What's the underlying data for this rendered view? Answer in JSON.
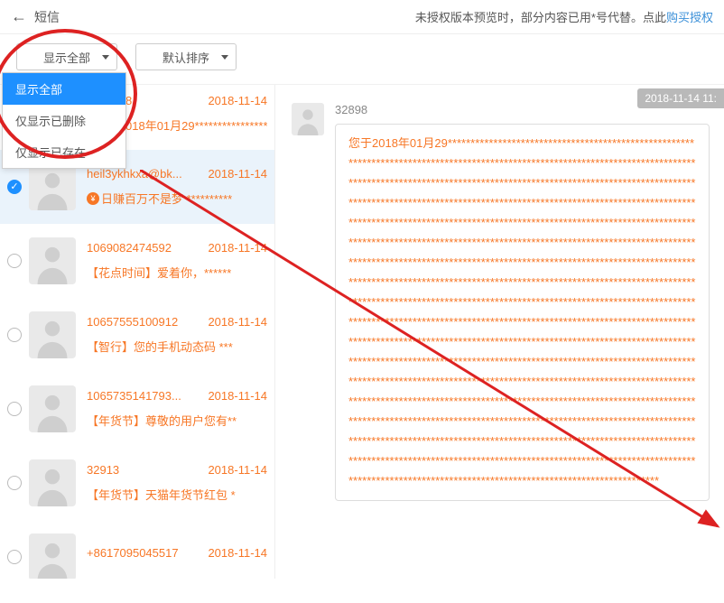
{
  "header": {
    "title": "短信",
    "notice_prefix": "未授权版本预览时，部分内容已用*号代替。点此",
    "notice_link": "购买授权"
  },
  "toolbar": {
    "filter_label": "显示全部",
    "sort_label": "默认排序",
    "filter_options": {
      "all": "显示全部",
      "deleted": "仅显示已删除",
      "existing": "仅显示已存在"
    }
  },
  "messages": [
    {
      "sender_partial": "8",
      "date": "2018-11-14",
      "preview": "018年01月29*******************",
      "checked": false
    },
    {
      "sender": "heil3ykhkxa@bk...",
      "date": "2018-11-14",
      "preview": "日赚百万不是梦 **********",
      "has_coin": true,
      "checked": true
    },
    {
      "sender": "1069082474592",
      "date": "2018-11-14",
      "preview": "【花点时间】爱着你，******",
      "checked": false
    },
    {
      "sender": "10657555100912",
      "date": "2018-11-14",
      "preview": "【智行】您的手机动态码 ***",
      "checked": false
    },
    {
      "sender": "1065735141793...",
      "date": "2018-11-14",
      "preview": "【年货节】尊敬的用户您有**",
      "checked": false
    },
    {
      "sender": "32913",
      "date": "2018-11-14",
      "preview": "【年货节】天猫年货节红包 *",
      "checked": false
    },
    {
      "sender": "+8617095045517",
      "date": "2018-11-14",
      "preview": "",
      "checked": false
    }
  ],
  "chat": {
    "date_chip": "2018-11-14 11:",
    "sender": "32898",
    "body": "您于2018年01月29******************************************************************************************************************************************************************************************************************************************************************************************************************************************************************************************************************************************************************************************************************************************************************************************************************************************************************************************************************************************************************************************************************************************************************************************************************************************************************************************************************************************************************************************************************************************************************************************************************************************************************************************************************************************************************************************"
  }
}
